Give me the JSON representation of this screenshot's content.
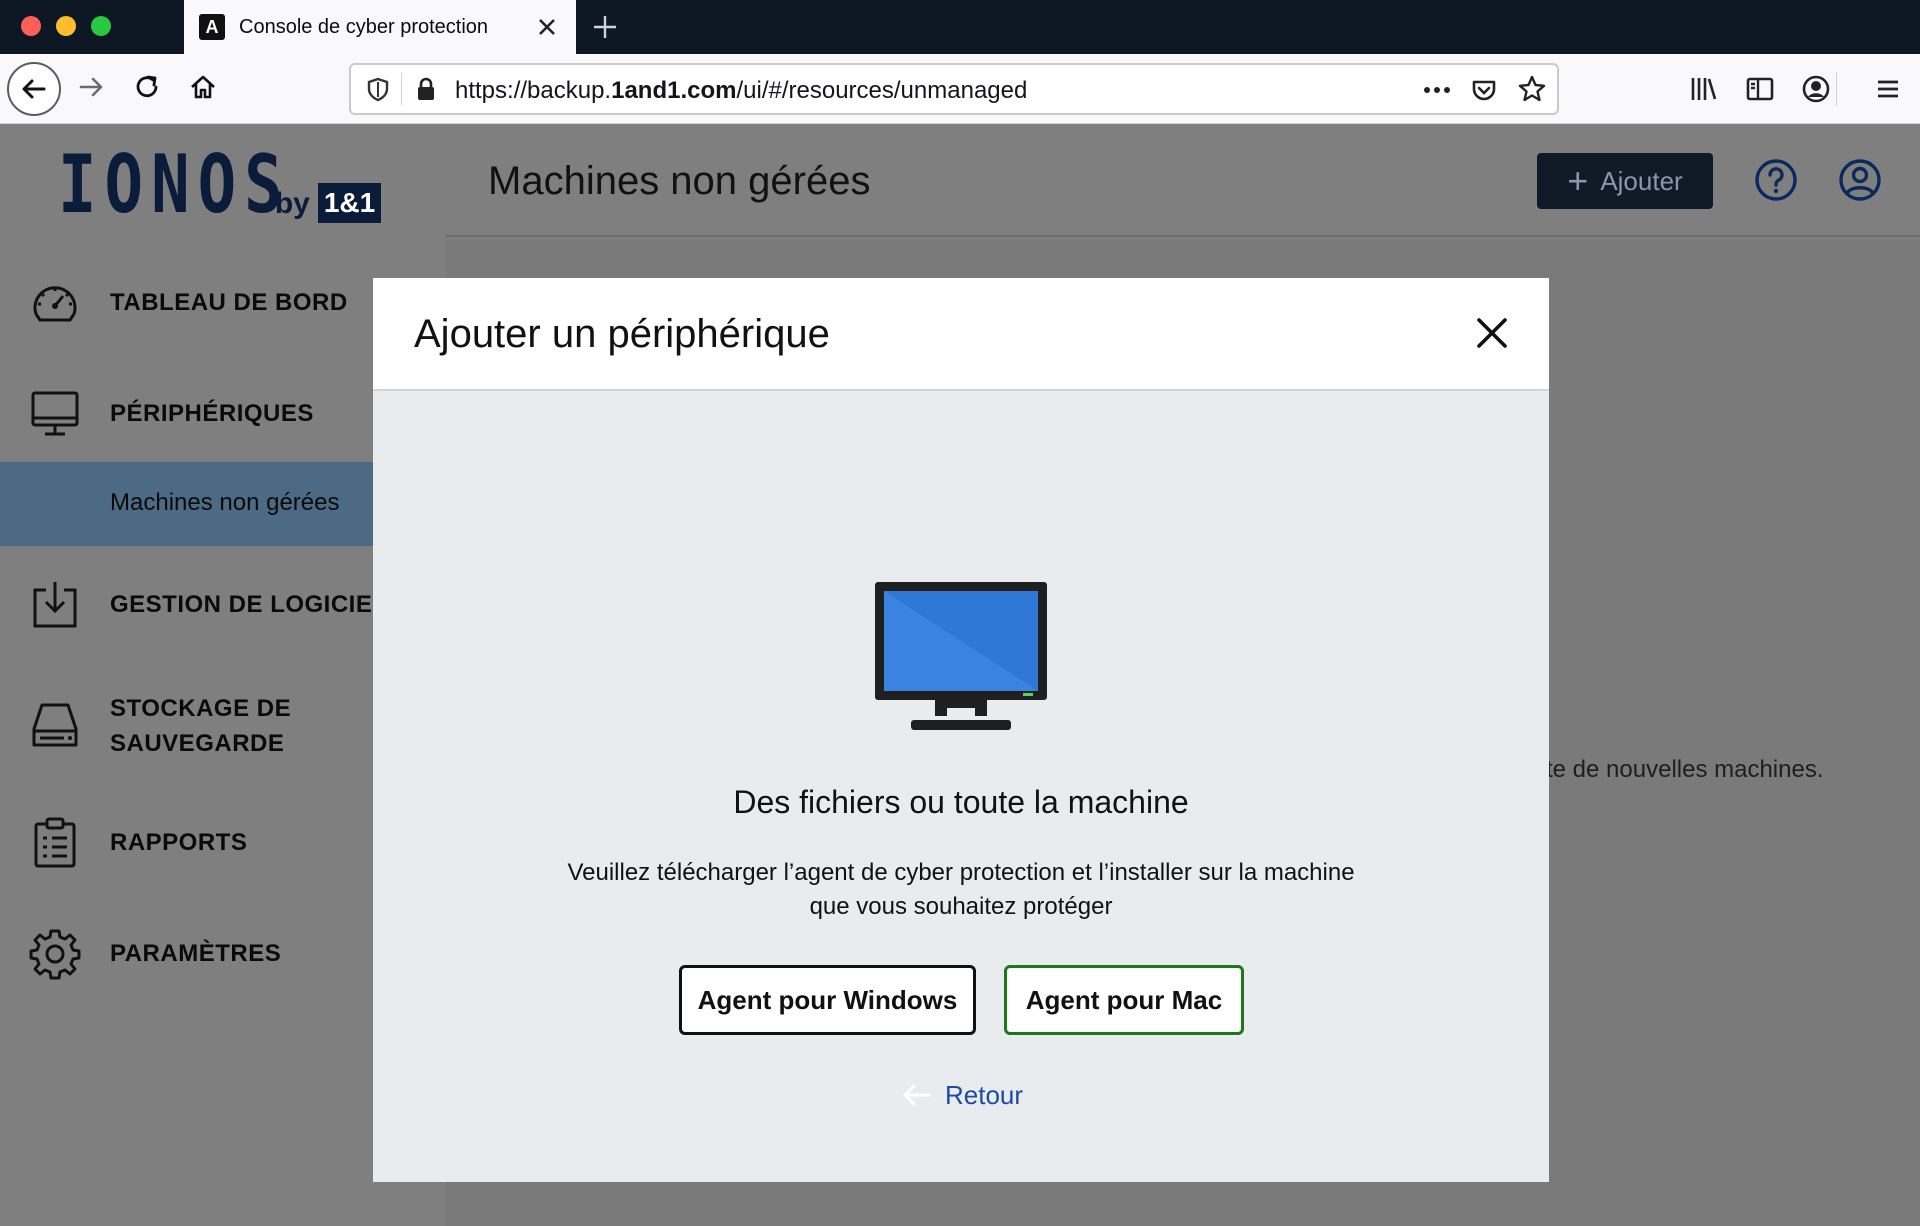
{
  "browser": {
    "tab_title": "Console de cyber protection",
    "tab_favicon": "A",
    "url_prefix": "https://backup.",
    "url_domain": "1and1.com",
    "url_path": "/ui/#/resources/unmanaged"
  },
  "logo": {
    "main": "IONOS",
    "by": "by",
    "brand": "1&1"
  },
  "sidebar": {
    "items": [
      {
        "label": "TABLEAU DE BORD",
        "icon": "dashboard-gauge-icon"
      },
      {
        "label": "PÉRIPHÉRIQUES",
        "icon": "monitor-icon"
      },
      {
        "label": "GESTION DE LOGICIEL",
        "icon": "download-box-icon"
      },
      {
        "label": "STOCKAGE DE SAUVEGARDE",
        "icon": "drive-icon"
      },
      {
        "label": "RAPPORTS",
        "icon": "clipboard-icon"
      },
      {
        "label": "PARAMÈTRES",
        "icon": "gear-icon"
      }
    ],
    "sub_item": "Machines non gérées"
  },
  "header": {
    "title": "Machines non gérées",
    "add_button": "Ajouter"
  },
  "background_text": "te de nouvelles machines.",
  "modal": {
    "title": "Ajouter un périphérique",
    "heading": "Des fichiers ou toute la machine",
    "description": "Veuillez télécharger l’agent de cyber protection et l’installer sur la machine que vous souhaitez protéger",
    "windows_button": "Agent pour Windows",
    "mac_button": "Agent pour Mac",
    "back_link": "Retour"
  },
  "colors": {
    "sidebar_active": "#4d6a85",
    "mac_button_border": "#1a7a1a",
    "link": "#1e4aa0",
    "screen_blue": "#2f78d6"
  }
}
